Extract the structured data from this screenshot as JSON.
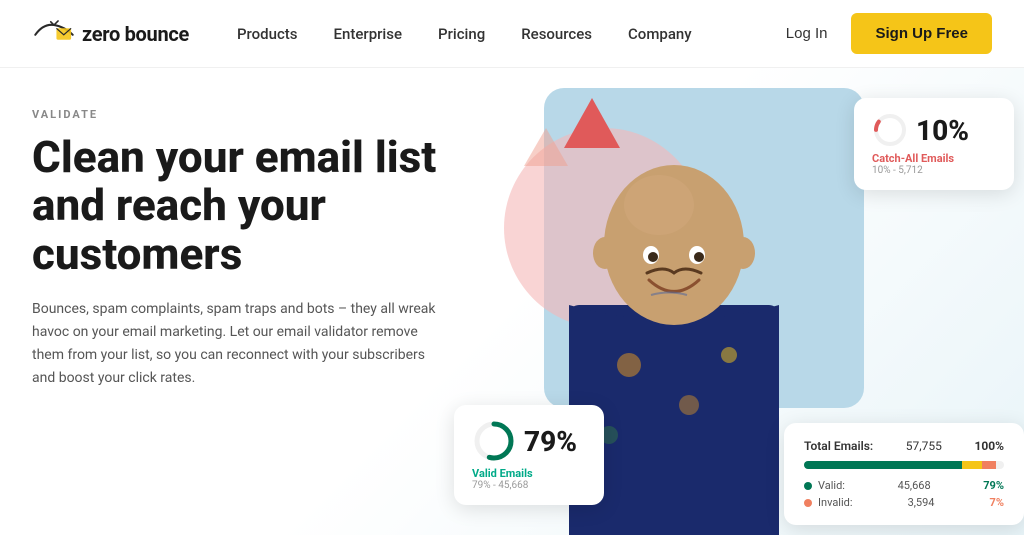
{
  "brand": {
    "name": "zero bounce",
    "logo_alt": "ZeroBounce logo"
  },
  "nav": {
    "links": [
      {
        "label": "Products",
        "id": "products"
      },
      {
        "label": "Enterprise",
        "id": "enterprise"
      },
      {
        "label": "Pricing",
        "id": "pricing"
      },
      {
        "label": "Resources",
        "id": "resources"
      },
      {
        "label": "Company",
        "id": "company"
      }
    ],
    "login_label": "Log In",
    "signup_label": "Sign Up Free"
  },
  "hero": {
    "validate_label": "VALIDATE",
    "title": "Clean your email list and reach your customers",
    "description": "Bounces, spam complaints, spam traps and bots – they all wreak havoc on your email marketing. Let our email validator remove them from your list, so you can reconnect with your subscribers and boost your click rates."
  },
  "stats": {
    "catch_all": {
      "percent": "10%",
      "label": "Catch-All Emails",
      "sub": "10% - 5,712"
    },
    "valid": {
      "percent": "79%",
      "label": "Valid Emails",
      "sub": "79% - 45,668"
    },
    "table": {
      "total_label": "Total Emails:",
      "total_value": "57,755",
      "total_pct": "100%",
      "rows": [
        {
          "dot_color": "#007755",
          "label": "Valid:",
          "value": "45,668",
          "pct": "79%",
          "pct_color": "#007755"
        },
        {
          "dot_color": "#f08060",
          "label": "Invalid:",
          "value": "3,594",
          "pct": "7%",
          "pct_color": "#f08060"
        }
      ],
      "bar_valid_width": "79",
      "bar_catchall_width": "10",
      "bar_invalid_width": "7"
    }
  },
  "colors": {
    "signup_bg": "#f5c518",
    "valid_color": "#007755",
    "invalid_color": "#f08060",
    "catchall_color": "#e05a5a",
    "accent_blue": "#b8d8e8"
  }
}
